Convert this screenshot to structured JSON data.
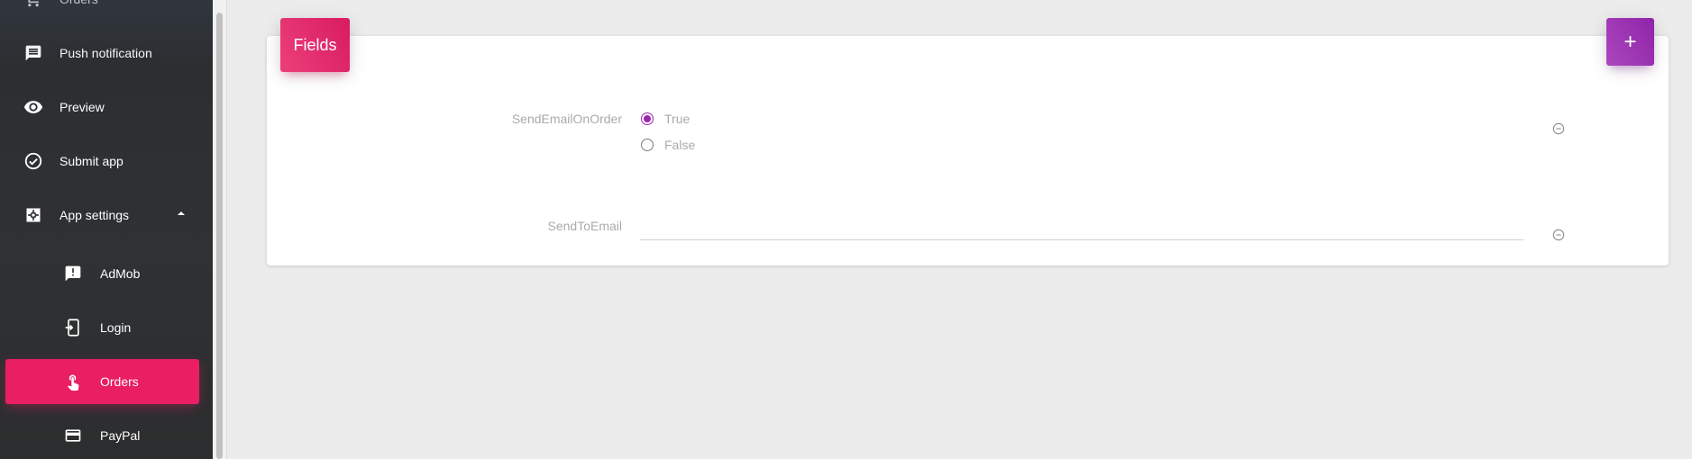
{
  "sidebar": {
    "items": [
      {
        "label": "Orders",
        "icon": "cart-icon"
      },
      {
        "label": "Push notification",
        "icon": "list-icon"
      },
      {
        "label": "Preview",
        "icon": "eye-icon"
      },
      {
        "label": "Submit app",
        "icon": "check-circle-icon"
      },
      {
        "label": "App settings",
        "icon": "settings-icon",
        "expanded": true
      },
      {
        "label": "AdMob",
        "icon": "feedback-icon"
      },
      {
        "label": "Login",
        "icon": "phone-login-icon"
      },
      {
        "label": "Orders",
        "icon": "touch-icon",
        "active": true
      },
      {
        "label": "PayPal",
        "icon": "credit-card-icon"
      }
    ]
  },
  "card": {
    "title": "Fields",
    "add_label": "+"
  },
  "fields": {
    "send_email_on_order": {
      "label": "SendEmailOnOrder",
      "options": [
        "True",
        "False"
      ],
      "selected": "True"
    },
    "send_to_email": {
      "label": "SendToEmail",
      "value": ""
    }
  },
  "colors": {
    "primary": "#e91e63",
    "accent": "#9c27b0",
    "sidebar_bg": "#2e3032",
    "page_bg": "#ececec"
  }
}
